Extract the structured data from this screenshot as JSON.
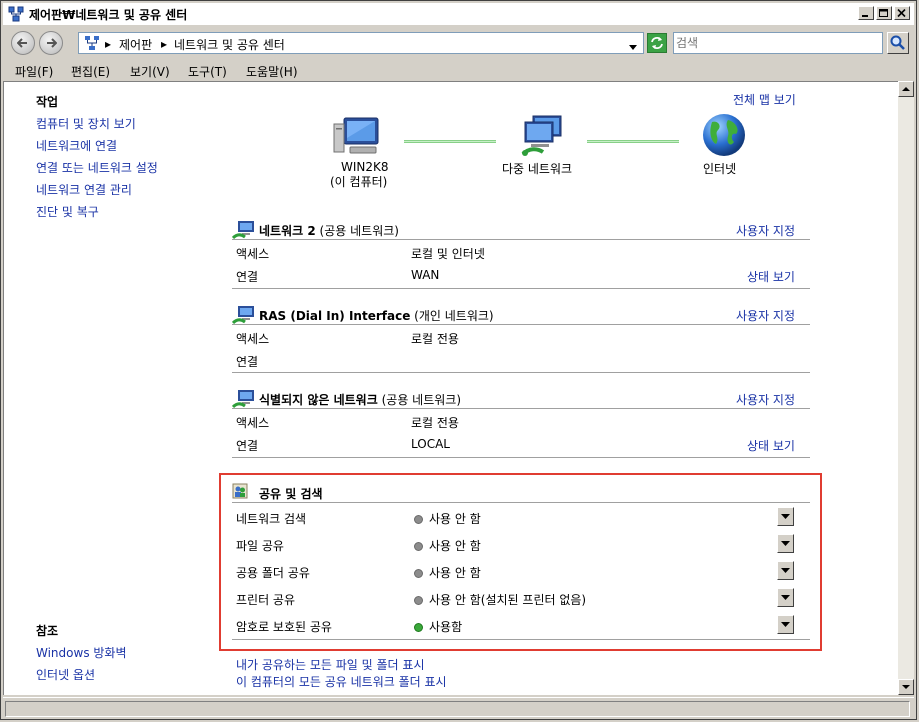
{
  "window": {
    "title": "제어판₩네트워크 및 공유 센터"
  },
  "address": {
    "segments": [
      "제어판",
      "네트워크 및 공유 센터"
    ]
  },
  "search": {
    "placeholder": "검색"
  },
  "menu": [
    "파일(F)",
    "편집(E)",
    "보기(V)",
    "도구(T)",
    "도움말(H)"
  ],
  "sidebar": {
    "tasks_title": "작업",
    "tasks": [
      "컴퓨터 및 장치 보기",
      "네트워크에 연결",
      "연결 또는 네트워크 설정",
      "네트워크 연결 관리",
      "진단 및 복구"
    ],
    "see_also_title": "참조",
    "see_also": [
      "Windows 방화벽",
      "인터넷 옵션"
    ]
  },
  "map": {
    "full_map_link": "전체 맵 보기",
    "computer_name": "WIN2K8",
    "computer_sub": "(이 컴퓨터)",
    "middle_label": "다중 네트워크",
    "internet_label": "인터넷"
  },
  "networks": [
    {
      "name": "네트워크  2",
      "type": "(공용 네트워크)",
      "customize": "사용자 지정",
      "rows": [
        {
          "label": "액세스",
          "value": "로컬 및 인터넷",
          "link": ""
        },
        {
          "label": "연결",
          "value": "WAN",
          "link": "상태 보기"
        }
      ]
    },
    {
      "name": "RAS (Dial In) Interface",
      "type": "(개인 네트워크)",
      "customize": "사용자 지정",
      "rows": [
        {
          "label": "액세스",
          "value": "로컬 전용",
          "link": ""
        },
        {
          "label": "연결",
          "value": "",
          "link": ""
        }
      ]
    },
    {
      "name": "식별되지 않은 네트워크",
      "type": "(공용 네트워크)",
      "customize": "사용자 지정",
      "rows": [
        {
          "label": "액세스",
          "value": "로컬 전용",
          "link": ""
        },
        {
          "label": "연결",
          "value": "LOCAL",
          "link": "상태 보기"
        }
      ]
    }
  ],
  "sharing": {
    "title": "공유 및 검색",
    "rows": [
      {
        "label": "네트워크 검색",
        "status": "사용 안 함",
        "on": false
      },
      {
        "label": "파일 공유",
        "status": "사용 안 함",
        "on": false
      },
      {
        "label": "공용 폴더 공유",
        "status": "사용 안 함",
        "on": false
      },
      {
        "label": "프린터 공유",
        "status": "사용 안 함(설치된 프린터 없음)",
        "on": false
      },
      {
        "label": "암호로 보호된 공유",
        "status": "사용함",
        "on": true
      }
    ]
  },
  "bottom_links": [
    "내가 공유하는 모든 파일 및 폴더 표시",
    "이 컴퓨터의 모든 공유 네트워크 폴더 표시"
  ],
  "colors": {
    "link": "#1a33a6",
    "highlight_border": "#e03c31",
    "status_off": "#8c8c8c",
    "status_on": "#3aa83a"
  }
}
